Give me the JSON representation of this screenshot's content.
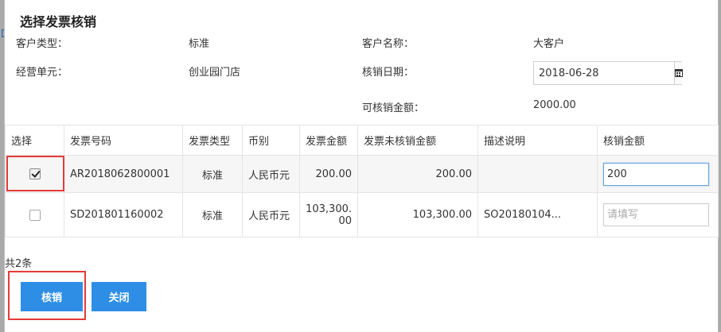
{
  "dialog": {
    "title": "选择发票核销",
    "customer_type_label": "客户类型：",
    "customer_type_value": "标准",
    "customer_name_label": "客户名称：",
    "customer_name_value": "大客户",
    "business_unit_label": "经营单元：",
    "business_unit_value": "创业园门店",
    "writeoff_date_label": "核销日期：",
    "writeoff_date_value": "2018-06-28",
    "available_amount_label": "可核销金额：",
    "available_amount_value": "2000.00"
  },
  "table": {
    "columns": [
      "选择",
      "发票号码",
      "发票类型",
      "币别",
      "发票金额",
      "发票未核销金额",
      "描述说明",
      "核销金额"
    ],
    "rows": [
      {
        "checked": true,
        "invoice_no": "AR2018062800001",
        "invoice_type": "标准",
        "currency": "人民币元",
        "amount": "200.00",
        "unwritten_amount": "200.00",
        "description": "",
        "writeoff_value": "200",
        "writeoff_placeholder": ""
      },
      {
        "checked": false,
        "invoice_no": "SD201801160002",
        "invoice_type": "标准",
        "currency": "人民币元",
        "amount_line1": "103,300.",
        "amount_line2": "00",
        "unwritten_amount": "103,300.00",
        "description": "SO20180104...",
        "writeoff_value": "",
        "writeoff_placeholder": "请填写"
      }
    ],
    "total_text": "共2条"
  },
  "buttons": {
    "writeoff": "核销",
    "close": "关闭"
  },
  "colors": {
    "primary": "#2e8ee6",
    "highlight": "#e53a3a"
  }
}
